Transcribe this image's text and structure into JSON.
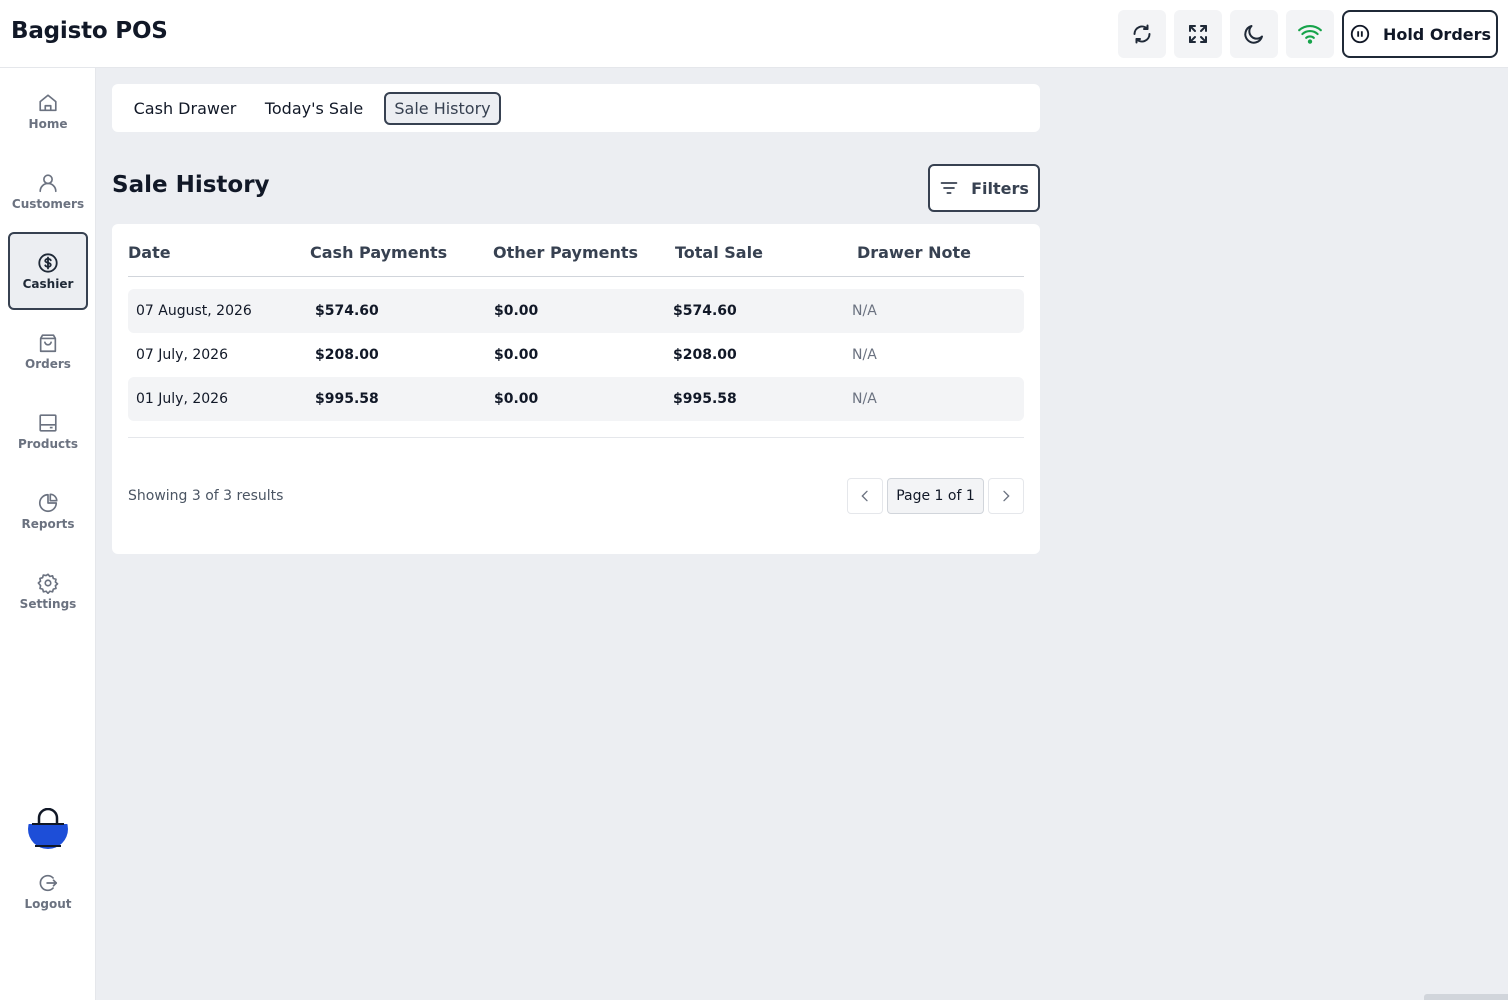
{
  "app": {
    "title": "Bagisto POS"
  },
  "header": {
    "hold_orders_label": "Hold Orders",
    "icons": {
      "sync": "sync-icon",
      "fullscreen": "fullscreen-icon",
      "theme": "moon-icon",
      "network": "wifi-icon"
    },
    "network_color": "#16a34a"
  },
  "sidebar": {
    "items": [
      {
        "label": "Home",
        "icon": "home-icon"
      },
      {
        "label": "Customers",
        "icon": "user-icon"
      },
      {
        "label": "Cashier",
        "icon": "dollar-circle-icon",
        "active": true
      },
      {
        "label": "Orders",
        "icon": "shopping-bag-icon"
      },
      {
        "label": "Products",
        "icon": "product-box-icon"
      },
      {
        "label": "Reports",
        "icon": "pie-chart-icon"
      },
      {
        "label": "Settings",
        "icon": "gear-icon"
      }
    ],
    "logout_label": "Logout",
    "avatar_color": "#1d4ed8"
  },
  "tabs": [
    {
      "label": "Cash Drawer"
    },
    {
      "label": "Today's Sale"
    },
    {
      "label": "Sale History",
      "active": true
    }
  ],
  "page": {
    "title": "Sale History",
    "filters_label": "Filters"
  },
  "table": {
    "columns": [
      "Date",
      "Cash Payments",
      "Other Payments",
      "Total Sale",
      "Drawer Note"
    ],
    "rows": [
      {
        "date": "07 August, 2026",
        "cash": "$574.60",
        "other": "$0.00",
        "total": "$574.60",
        "note": "N/A"
      },
      {
        "date": "07 July, 2026",
        "cash": "$208.00",
        "other": "$0.00",
        "total": "$208.00",
        "note": "N/A"
      },
      {
        "date": "01 July, 2026",
        "cash": "$995.58",
        "other": "$0.00",
        "total": "$995.58",
        "note": "N/A"
      }
    ]
  },
  "pagination": {
    "showing": "Showing 3 of 3 results",
    "page_label": "Page 1 of 1"
  }
}
